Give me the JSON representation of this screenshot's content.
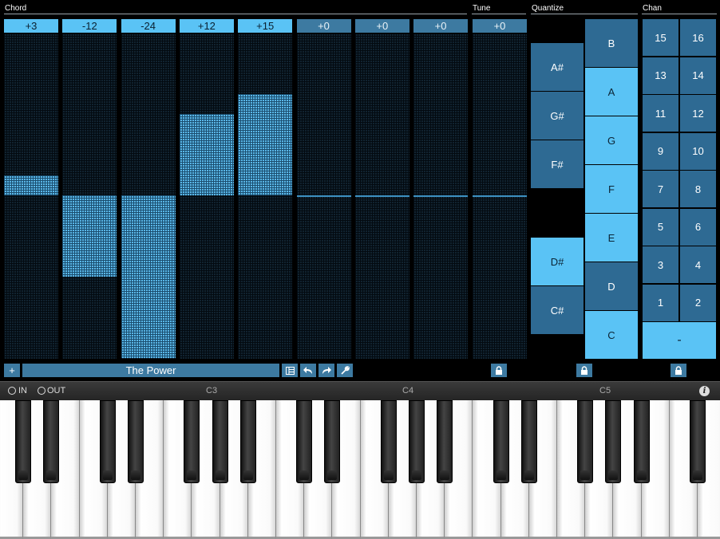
{
  "sections": {
    "chord": "Chord",
    "tune": "Tune",
    "quantize": "Quantize",
    "chan": "Chan"
  },
  "columns": [
    {
      "label": "+3",
      "active": true,
      "value": 3
    },
    {
      "label": "-12",
      "active": true,
      "value": -12
    },
    {
      "label": "-24",
      "active": true,
      "value": -24
    },
    {
      "label": "+12",
      "active": true,
      "value": 12
    },
    {
      "label": "+15",
      "active": true,
      "value": 15
    },
    {
      "label": "+0",
      "active": false,
      "value": 0
    },
    {
      "label": "+0",
      "active": false,
      "value": 0
    },
    {
      "label": "+0",
      "active": false,
      "value": 0
    }
  ],
  "tune": {
    "label": "+0",
    "value": 0
  },
  "quantize": {
    "black_keys": [
      {
        "label": "A#",
        "on": false
      },
      {
        "label": "G#",
        "on": false
      },
      {
        "label": "F#",
        "on": false
      },
      {
        "label": "D#",
        "on": true
      },
      {
        "label": "C#",
        "on": false
      }
    ],
    "white_keys": [
      {
        "label": "B",
        "on": false
      },
      {
        "label": "A",
        "on": true
      },
      {
        "label": "G",
        "on": true
      },
      {
        "label": "F",
        "on": true
      },
      {
        "label": "E",
        "on": true
      },
      {
        "label": "D",
        "on": false
      },
      {
        "label": "C",
        "on": true
      }
    ]
  },
  "channels": {
    "rows": [
      [
        "15",
        "16"
      ],
      [
        "13",
        "14"
      ],
      [
        "11",
        "12"
      ],
      [
        "9",
        "10"
      ],
      [
        "7",
        "8"
      ],
      [
        "5",
        "6"
      ],
      [
        "3",
        "4"
      ],
      [
        "1",
        "2"
      ]
    ],
    "dash": "-"
  },
  "toolbar": {
    "add": "+",
    "preset_name": "The Power"
  },
  "keyboard_bar": {
    "in": "IN",
    "out": "OUT",
    "octaves": [
      "C3",
      "C4",
      "C5"
    ],
    "info": "i"
  },
  "colors": {
    "accent": "#5ac3f5",
    "panel": "#2e6a93",
    "header": "#3d7aa1"
  }
}
